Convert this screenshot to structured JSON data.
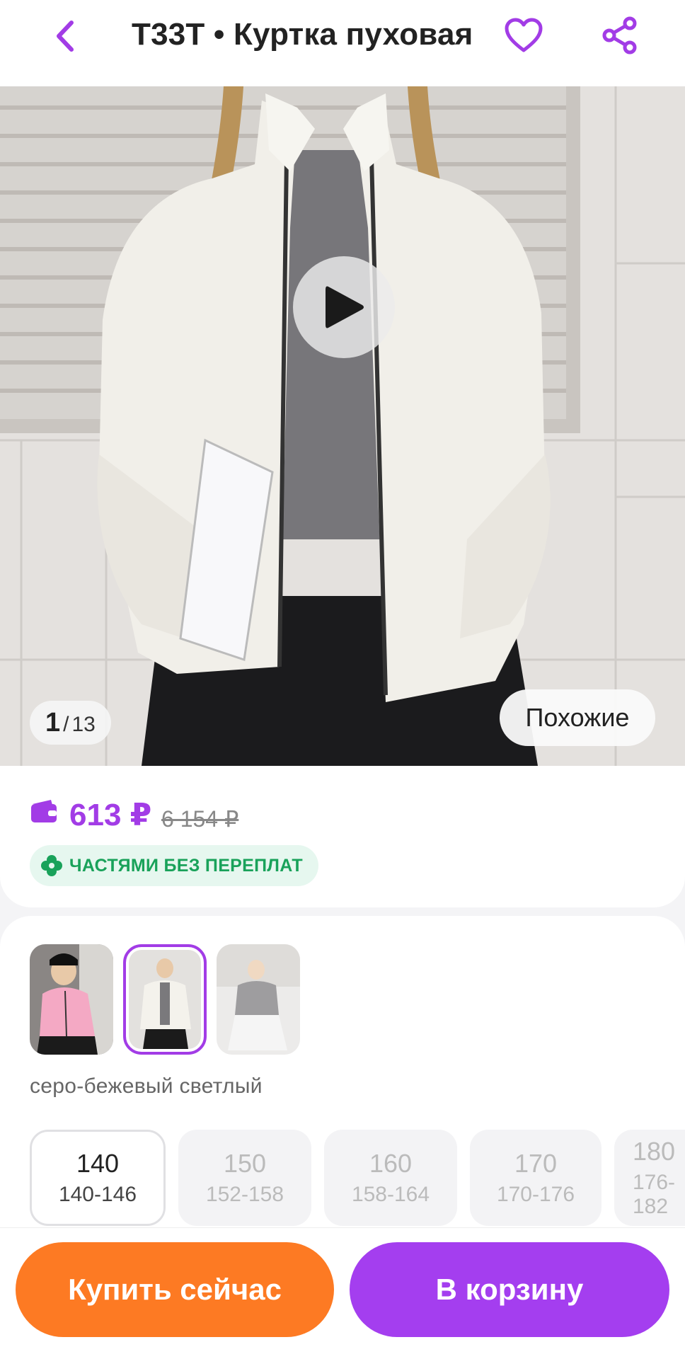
{
  "header": {
    "title": "T33T • Куртка пуховая",
    "back_icon": "chevron-left-icon",
    "favorite_icon": "heart-icon",
    "share_icon": "share-icon",
    "accent": "#a23ce6"
  },
  "gallery": {
    "current": "1",
    "separator": "/",
    "total": "13",
    "similar_label": "Похожие",
    "play_icon": "play-icon"
  },
  "price": {
    "current": "613 ₽",
    "old": "6 154 ₽",
    "installment_label": "ЧАСТЯМИ БЕЗ ПЕРЕПЛАТ",
    "price_color": "#a23ce6",
    "installment_color": "#19a25a"
  },
  "variants": {
    "color_name": "серо-бежевый светлый",
    "thumbnails": [
      "pink-jacket-thumb",
      "white-jacket-thumb",
      "black-outfit-thumb"
    ],
    "selected_index": 1
  },
  "sizes": [
    {
      "size": "140",
      "range": "140-146",
      "selected": true
    },
    {
      "size": "150",
      "range": "152-158",
      "selected": false
    },
    {
      "size": "160",
      "range": "158-164",
      "selected": false
    },
    {
      "size": "170",
      "range": "170-176",
      "selected": false
    },
    {
      "size": "180",
      "range": "176-182",
      "selected": false
    }
  ],
  "actions": {
    "buy_now": "Купить сейчас",
    "add_to_cart": "В корзину",
    "buy_color": "#fd7a23",
    "cart_color": "#a43eef"
  }
}
